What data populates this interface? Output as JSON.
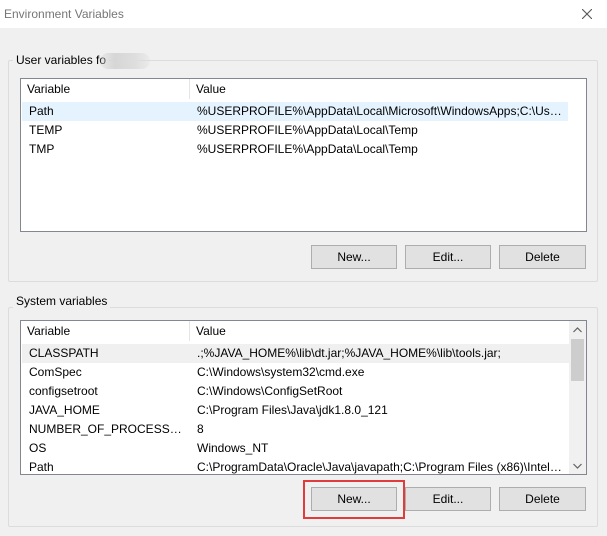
{
  "window": {
    "title": "Environment Variables"
  },
  "user_group": {
    "label": "User variables fo",
    "columns": [
      "Variable",
      "Value"
    ],
    "rows": [
      {
        "variable": "Path",
        "value": "%USERPROFILE%\\AppData\\Local\\Microsoft\\WindowsApps;C:\\User..."
      },
      {
        "variable": "TEMP",
        "value": "%USERPROFILE%\\AppData\\Local\\Temp"
      },
      {
        "variable": "TMP",
        "value": "%USERPROFILE%\\AppData\\Local\\Temp"
      }
    ],
    "buttons": {
      "new": "New...",
      "edit": "Edit...",
      "delete": "Delete"
    }
  },
  "system_group": {
    "label": "System variables",
    "columns": [
      "Variable",
      "Value"
    ],
    "rows": [
      {
        "variable": "CLASSPATH",
        "value": ".;%JAVA_HOME%\\lib\\dt.jar;%JAVA_HOME%\\lib\\tools.jar;"
      },
      {
        "variable": "ComSpec",
        "value": "C:\\Windows\\system32\\cmd.exe"
      },
      {
        "variable": "configsetroot",
        "value": "C:\\Windows\\ConfigSetRoot"
      },
      {
        "variable": "JAVA_HOME",
        "value": "C:\\Program Files\\Java\\jdk1.8.0_121"
      },
      {
        "variable": "NUMBER_OF_PROCESSORS",
        "value": "8"
      },
      {
        "variable": "OS",
        "value": "Windows_NT"
      },
      {
        "variable": "Path",
        "value": "C:\\ProgramData\\Oracle\\Java\\javapath;C:\\Program Files (x86)\\Intel\\i..."
      }
    ],
    "buttons": {
      "new": "New...",
      "edit": "Edit...",
      "delete": "Delete"
    }
  },
  "icons": {
    "close": "close-icon",
    "scroll_up": "chevron-up-icon",
    "scroll_down": "chevron-down-icon"
  },
  "colors": {
    "selection": "#e5f3ff",
    "highlight_box": "#e03c3c",
    "button_face": "#e1e1e1"
  }
}
